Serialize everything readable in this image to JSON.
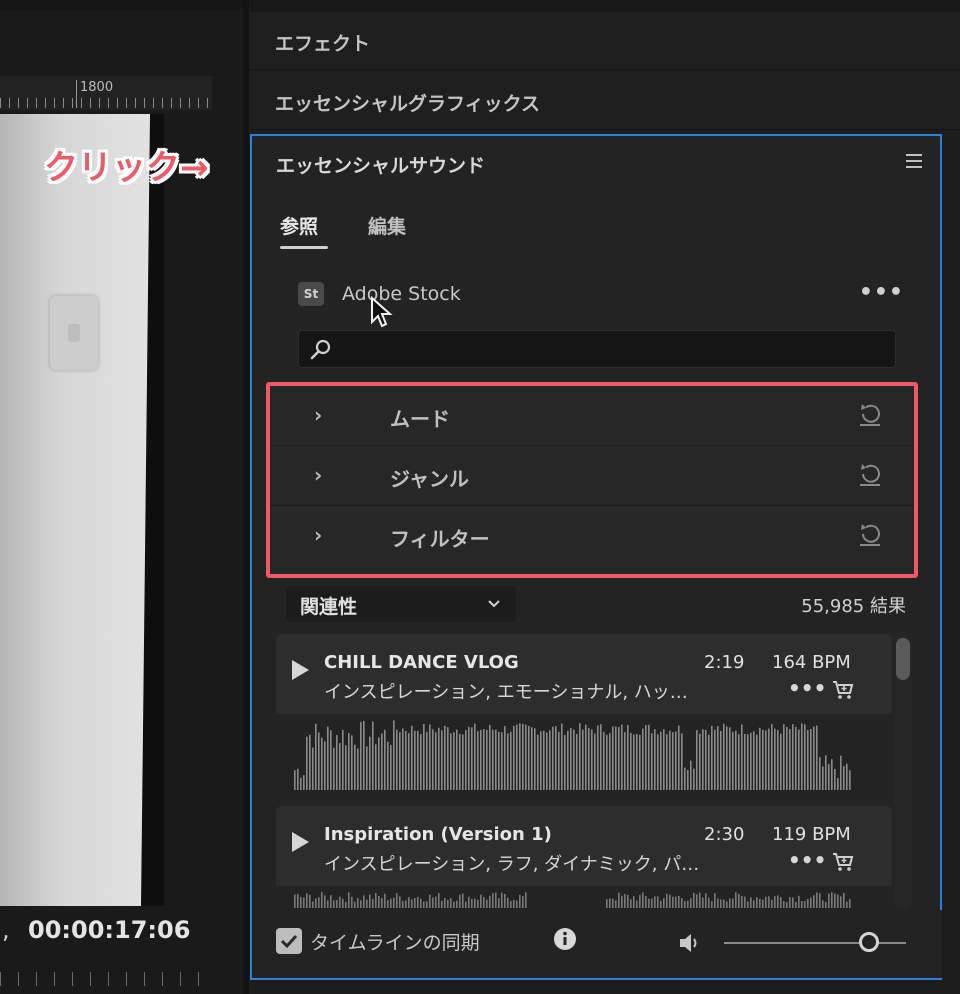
{
  "annotation": {
    "click_text": "クリック→",
    "highlight_color": "#ee5a66"
  },
  "monitor": {
    "ruler_label": "1800",
    "timecode": "00:00:17:06",
    "timecode_prefix": ","
  },
  "panels": {
    "effects": "エフェクト",
    "essential_graphics": "エッセンシャルグラフィックス",
    "essential_sound": "エッセンシャルサウンド"
  },
  "essential_sound": {
    "accent_color": "#2e7fd6",
    "tabs": [
      {
        "label": "参照",
        "active": true
      },
      {
        "label": "編集",
        "active": false
      }
    ],
    "stock": {
      "badge": "St",
      "label": "Adobe Stock",
      "more": "•••"
    },
    "search": {
      "placeholder": "",
      "value": ""
    },
    "filters": [
      {
        "label": "ムード"
      },
      {
        "label": "ジャンル"
      },
      {
        "label": "フィルター"
      }
    ],
    "sort": {
      "selected": "関連性"
    },
    "result_count": "55,985 結果",
    "tracks": [
      {
        "title": "CHILL DANCE VLOG",
        "duration": "2:19",
        "bpm": "164 BPM",
        "tags": "インスピレーション, エモーショナル, ハッ…",
        "more": "•••"
      },
      {
        "title": "Inspiration (Version 1)",
        "duration": "2:30",
        "bpm": "119 BPM",
        "tags": "インスピレーション, ラフ, ダイナミック, パ…",
        "more": "•••"
      }
    ],
    "footer": {
      "sync_label": "タイムラインの同期",
      "sync_checked": true,
      "volume_level": 0.8
    }
  }
}
